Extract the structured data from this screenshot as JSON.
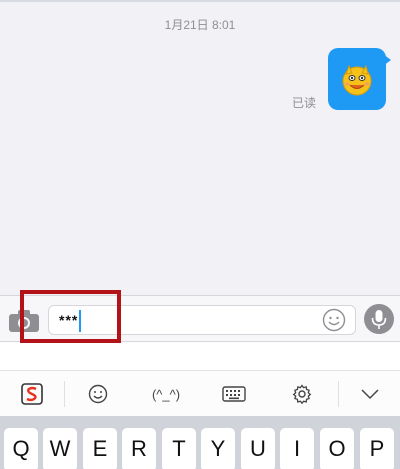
{
  "chat": {
    "timestamp": "1月21日 8:01",
    "message": {
      "type": "sticker",
      "read_status": "已读"
    }
  },
  "input": {
    "value": "***",
    "placeholder": ""
  },
  "ime_toolbar": {
    "kaomoji_label": "(^_^)",
    "items": [
      "sogou-logo-icon",
      "emoji-icon",
      "kaomoji",
      "keyboard-icon",
      "settings-gear-icon",
      "collapse-arrow-icon"
    ]
  },
  "keyboard": {
    "row1": [
      "Q",
      "W",
      "E",
      "R",
      "T",
      "Y",
      "U",
      "I",
      "O",
      "P"
    ]
  },
  "colors": {
    "accent_blue": "#1e9af5",
    "highlight_red": "#b31218",
    "chat_bg": "#f2f2f6"
  }
}
